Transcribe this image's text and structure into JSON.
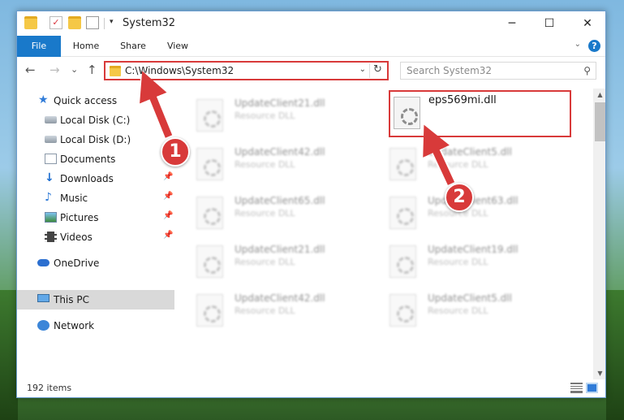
{
  "window": {
    "title": "System32",
    "controls": {
      "minimize": "─",
      "maximize": "☐",
      "close": "✕"
    }
  },
  "ribbon": {
    "tabs": [
      "File",
      "Home",
      "Share",
      "View"
    ],
    "expand_glyph": "⌄",
    "help_glyph": "?"
  },
  "nav": {
    "back_glyph": "←",
    "forward_glyph": "→",
    "recent_glyph": "⌄",
    "up_glyph": "↑",
    "address": "C:\\Windows\\System32",
    "address_caret": "⌄",
    "refresh_glyph": "↻",
    "search_placeholder": "Search System32",
    "search_glyph": "⚲"
  },
  "sidebar": {
    "items": [
      {
        "label": "Quick access",
        "icon": "star-icon",
        "pinned": false
      },
      {
        "label": "Local Disk (C:)",
        "icon": "drive-icon",
        "pinned": false
      },
      {
        "label": "Local Disk (D:)",
        "icon": "drive-icon",
        "pinned": false
      },
      {
        "label": "Documents",
        "icon": "documents-icon",
        "pinned": false
      },
      {
        "label": "Downloads",
        "icon": "download-icon",
        "pinned": true
      },
      {
        "label": "Music",
        "icon": "music-icon",
        "pinned": true
      },
      {
        "label": "Pictures",
        "icon": "pictures-icon",
        "pinned": true
      },
      {
        "label": "Videos",
        "icon": "videos-icon",
        "pinned": true
      },
      {
        "label": "OneDrive",
        "icon": "cloud-icon",
        "pinned": false
      },
      {
        "label": "This PC",
        "icon": "pc-icon",
        "pinned": false,
        "selected": true
      },
      {
        "label": "Network",
        "icon": "network-icon",
        "pinned": false
      }
    ],
    "pin_glyph": "📌"
  },
  "files": {
    "left_column": [
      {
        "name": "UpdateClient21.dll",
        "type": "Resource DLL"
      },
      {
        "name": "UpdateClient42.dll",
        "type": "Resource DLL"
      },
      {
        "name": "UpdateClient65.dll",
        "type": "Resource DLL"
      },
      {
        "name": "UpdateClient21.dll",
        "type": "Resource DLL"
      },
      {
        "name": "UpdateClient42.dll",
        "type": "Resource DLL"
      }
    ],
    "right_column": [
      {
        "name": "UpdateClient5.dll",
        "type": "Resource DLL"
      },
      {
        "name": "UpdateClient63.dll",
        "type": "Resource DLL"
      },
      {
        "name": "UpdateClient19.dll",
        "type": "Resource DLL"
      },
      {
        "name": "UpdateClient5.dll",
        "type": "Resource DLL"
      }
    ],
    "highlighted": {
      "name": "eps569mi.dll"
    }
  },
  "status": {
    "item_count": "192 items"
  },
  "annotations": {
    "step1": "1",
    "step2": "2",
    "color": "#d83a3a"
  }
}
